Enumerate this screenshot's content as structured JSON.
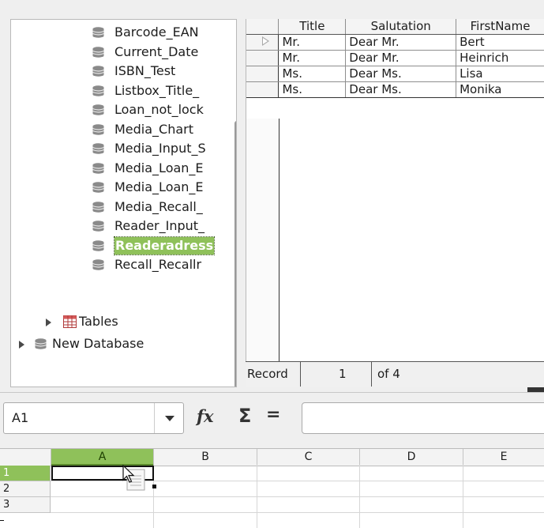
{
  "tree": {
    "queries": [
      "Barcode_EAN",
      "Current_Date",
      "ISBN_Test",
      "Listbox_Title_",
      "Loan_not_lock",
      "Media_Chart",
      "Media_Input_S",
      "Media_Loan_E",
      "Media_Loan_E",
      "Media_Recall_",
      "Reader_Input_",
      "Readeradress",
      "Recall_Recallr"
    ],
    "selected_index": 11,
    "tables_label": "Tables",
    "new_database_label": "New Database"
  },
  "grid": {
    "columns": [
      "Title",
      "Salutation",
      "FirstName"
    ],
    "rows": [
      [
        "Mr.",
        "Dear Mr.",
        "Bert"
      ],
      [
        "Mr.",
        "Dear Mr.",
        "Heinrich"
      ],
      [
        "Ms.",
        "Dear Ms.",
        "Lisa"
      ],
      [
        "Ms.",
        "Dear Ms.",
        "Monika"
      ]
    ]
  },
  "record_bar": {
    "label": "Record",
    "current": "1",
    "of_text": "of 4"
  },
  "formula_bar": {
    "name_box_value": "A1",
    "function_icon": "fx",
    "sum_icon": "Σ",
    "equals_icon": "=",
    "formula_value": ""
  },
  "sheet": {
    "columns": [
      "A",
      "B",
      "C",
      "D",
      "E"
    ],
    "rows": [
      "1",
      "2",
      "3"
    ],
    "active_cell": "A1"
  },
  "colors": {
    "selection": "#8fc15a",
    "database_icon": "#7a7a7a"
  }
}
